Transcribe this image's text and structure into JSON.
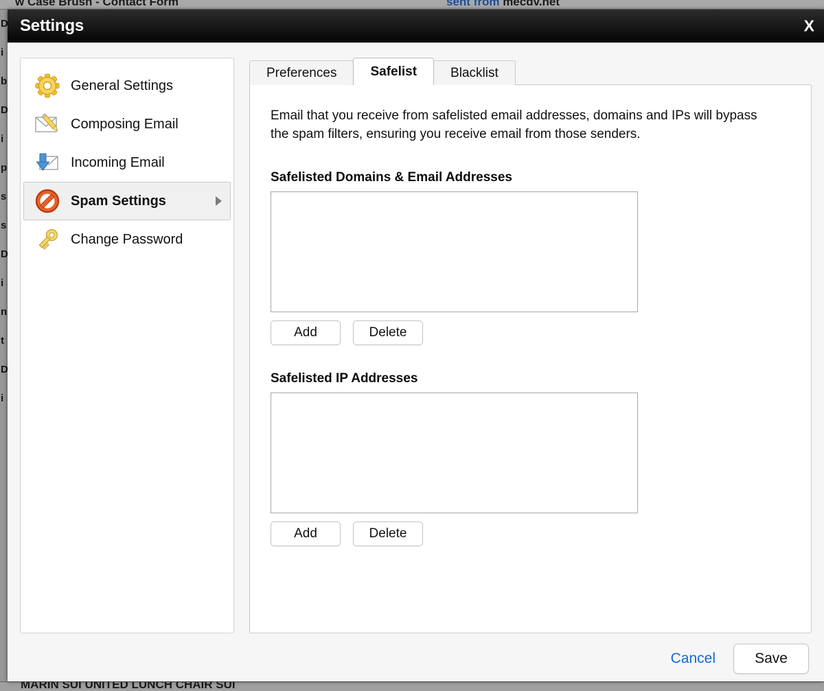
{
  "background": {
    "topbar_left": "w Case Brush - Contact Form",
    "topbar_right_blue": "sent from",
    "topbar_right_rest": " mecdv.net",
    "left_column_chars": "D i b D i p s s D i n t D i",
    "bottom_text": "MARIN SUI UNITED LUNCH CHAIR SUI"
  },
  "modal": {
    "title": "Settings",
    "close_label": "X"
  },
  "sidebar": {
    "items": [
      {
        "label": "General Settings",
        "icon": "gear-icon",
        "selected": false,
        "has_arrow": false
      },
      {
        "label": "Composing Email",
        "icon": "envelope-pencil-icon",
        "selected": false,
        "has_arrow": false
      },
      {
        "label": "Incoming Email",
        "icon": "envelope-download-icon",
        "selected": false,
        "has_arrow": false
      },
      {
        "label": "Spam Settings",
        "icon": "no-entry-icon",
        "selected": true,
        "has_arrow": true
      },
      {
        "label": "Change Password",
        "icon": "key-icon",
        "selected": false,
        "has_arrow": false
      }
    ]
  },
  "tabs": [
    {
      "label": "Preferences",
      "active": false
    },
    {
      "label": "Safelist",
      "active": true
    },
    {
      "label": "Blacklist",
      "active": false
    }
  ],
  "panel": {
    "intro": "Email that you receive from safelisted email addresses, domains and IPs will bypass the spam filters, ensuring you receive email from those senders.",
    "sections": [
      {
        "heading": "Safelisted Domains & Email Addresses",
        "items": [],
        "add_label": "Add",
        "delete_label": "Delete"
      },
      {
        "heading": "Safelisted IP Addresses",
        "items": [],
        "add_label": "Add",
        "delete_label": "Delete"
      }
    ]
  },
  "footer": {
    "cancel_label": "Cancel",
    "save_label": "Save"
  },
  "colors": {
    "header_bg": "#0d0d0d",
    "link_blue": "#1269d3",
    "accent_selected": "#f0f0f0",
    "panel_bg": "#ffffff"
  }
}
